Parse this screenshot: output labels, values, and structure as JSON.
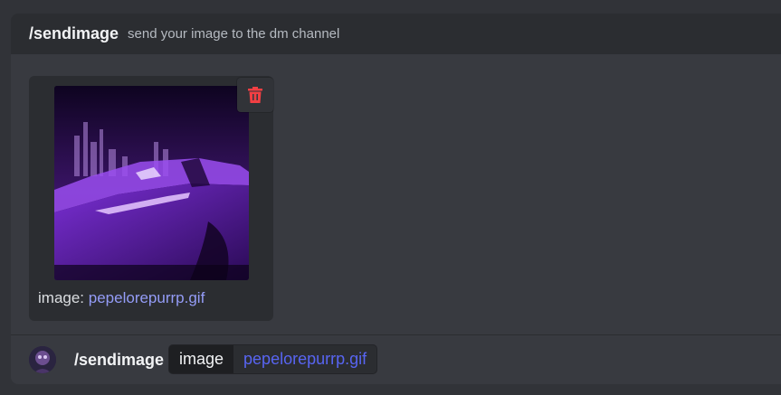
{
  "command_header": {
    "name": "/sendimage",
    "description": "send your image to the dm channel"
  },
  "attachment": {
    "caption_label": "image:",
    "filename": "pepelorepurrp.gif",
    "delete_icon": "trash-icon"
  },
  "input": {
    "command": "/sendimage",
    "option_name": "image",
    "option_value": "pepelorepurrp.gif"
  },
  "colors": {
    "background": "#313338",
    "panel": "#383a40",
    "header": "#2b2d31",
    "danger": "#f23f43",
    "link": "#949cf7",
    "accent": "#5865f2"
  }
}
